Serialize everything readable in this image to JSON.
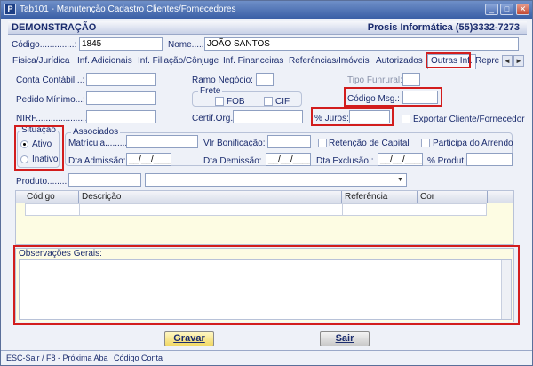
{
  "window": {
    "title": "Tab101 - Manutenção Cadastro Clientes/Fornecedores",
    "app_icon": "P",
    "buttons": [
      "_",
      "□",
      "✕"
    ]
  },
  "header": {
    "left": "DEMONSTRAÇÃO",
    "right": "Prosis Informática (55)3332-7273"
  },
  "record": {
    "codigo_label": "Código..............:",
    "codigo_value": "1845",
    "nome_label": "Nome.....:",
    "nome_value": "JOÃO SANTOS"
  },
  "tabs": [
    "Física/Jurídica",
    "Inf. Adicionais",
    "Inf. Filiação/Cônjuge",
    "Inf. Financeiras",
    "Referências/Imóveis",
    "Autorizados",
    "Outras Inf.",
    "Repre"
  ],
  "tab_scroll": {
    "left": "◄",
    "right": "►"
  },
  "form": {
    "conta_contabil": "Conta Contábil...:",
    "pedido_minimo": "Pedido Mínimo...:",
    "nirf": "NIRF.......................:",
    "ramo_negocio": "Ramo Negócio:",
    "tipo_funrural": "Tipo Funrural:",
    "frete_title": "Frete",
    "frete_fob": "FOB",
    "frete_cif": "CIF",
    "codigo_msg": "Código Msg.:",
    "certif_org": "Certif.Org.:",
    "perc_juros": "% Juros:",
    "exportar": "Exportar Cliente/Fornecedor"
  },
  "situacao": {
    "title": "Situação",
    "ativo": "Ativo",
    "inativo": "Inativo",
    "selected": "Ativo"
  },
  "associados": {
    "title": "Associados",
    "matricula": "Matrícula..........:",
    "vlr_bonificacao": "Vlr Bonificação:",
    "retencao": "Retenção de Capital",
    "participa": "Participa do Arrendo",
    "dta_admissao": "Dta Admissão:",
    "dta_admissao_value": "__/__/____",
    "dta_demissao": "Dta Demissão:",
    "dta_demissao_value": "__/__/____",
    "dta_exclusao": "Dta Exclusão.:",
    "dta_exclusao_value": "__/__/____",
    "perc_produt": "% Produt:"
  },
  "produto": {
    "label": "Produto........:"
  },
  "grid": {
    "columns": [
      "Código",
      "Descrição",
      "Referência",
      "Cor"
    ]
  },
  "obs": {
    "label": "Observações Gerais:"
  },
  "buttons": {
    "gravar": "Gravar",
    "sair": "Sair"
  },
  "status": {
    "left": "ESC-Sair / F8 - Próxima Aba",
    "right": "Código Conta"
  },
  "colors": {
    "highlight_border": "#d21d1d",
    "title_bar": "#3a5fa6",
    "grid_bg": "#fdfce3"
  }
}
